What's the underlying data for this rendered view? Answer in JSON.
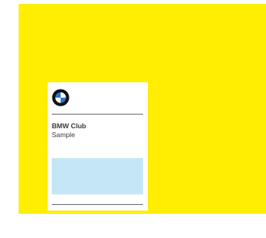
{
  "page": {
    "background": "#ffffff",
    "canvas_color": "#ffee00"
  },
  "card": {
    "logo_icon": "bmw-logo-icon",
    "title": "BMW Club",
    "subtitle": "Sample",
    "media_placeholder_color": "#c5e6f7"
  }
}
